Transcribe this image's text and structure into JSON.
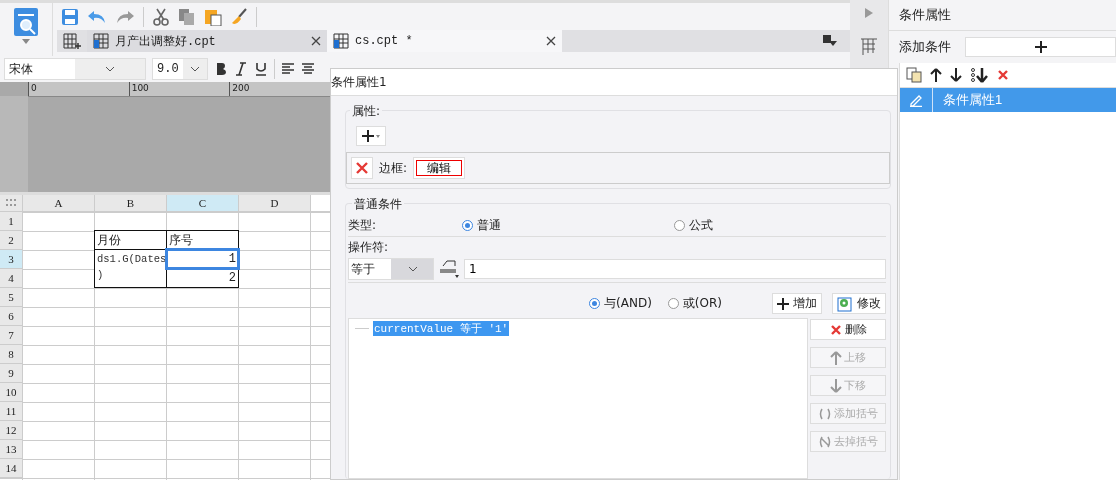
{
  "tabs": [
    {
      "label": "月产出调整好.cpt",
      "selected": false
    },
    {
      "label": "cs.cpt *",
      "selected": true
    }
  ],
  "format_bar": {
    "font": "宋体",
    "size": "9.0"
  },
  "ruler": {
    "ticks": [
      "0",
      "100",
      "200"
    ]
  },
  "sheet": {
    "columns": [
      "A",
      "B",
      "C",
      "D"
    ],
    "rows": [
      {
        "label": "1",
        "cells": [
          null,
          null,
          null,
          null
        ]
      },
      {
        "label": "2",
        "cells": [
          null,
          {
            "kind": "text",
            "lines": [
              "月份"
            ],
            "selected": false,
            "merged_down": false
          },
          {
            "kind": "text",
            "lines": [
              "序号"
            ],
            "selected": false,
            "merged_down": false
          },
          null
        ]
      },
      {
        "label": "3",
        "cells": [
          null,
          {
            "kind": "formula",
            "lines": [
              "ds1.G(Dates",
              ")"
            ],
            "selected": false,
            "merged_down": true
          },
          {
            "kind": "number",
            "lines": [
              "1"
            ],
            "selected": true,
            "merged_down": false
          },
          null
        ]
      },
      {
        "label": "4",
        "cells": [
          null,
          null,
          {
            "kind": "number",
            "lines": [
              "2"
            ],
            "selected": false,
            "merged_down": false
          },
          null
        ]
      },
      {
        "label": "5",
        "cells": [
          null,
          null,
          null,
          null
        ]
      },
      {
        "label": "6",
        "cells": [
          null,
          null,
          null,
          null
        ]
      },
      {
        "label": "7",
        "cells": [
          null,
          null,
          null,
          null
        ]
      },
      {
        "label": "8",
        "cells": [
          null,
          null,
          null,
          null
        ]
      },
      {
        "label": "9",
        "cells": [
          null,
          null,
          null,
          null
        ]
      },
      {
        "label": "10",
        "cells": [
          null,
          null,
          null,
          null
        ]
      },
      {
        "label": "11",
        "cells": [
          null,
          null,
          null,
          null
        ]
      },
      {
        "label": "12",
        "cells": [
          null,
          null,
          null,
          null
        ]
      },
      {
        "label": "13",
        "cells": [
          null,
          null,
          null,
          null
        ]
      },
      {
        "label": "14",
        "cells": [
          null,
          null,
          null,
          null
        ]
      }
    ]
  },
  "dialog": {
    "title": "条件属性1",
    "attributes": {
      "legend": "属性:",
      "items": [
        {
          "label": "边框:",
          "button": "编辑"
        }
      ]
    },
    "condition": {
      "legend": "普通条件",
      "type_label": "类型:",
      "types": [
        {
          "label": "普通",
          "selected": true
        },
        {
          "label": "公式",
          "selected": false
        }
      ],
      "operator_label": "操作符:",
      "operator": "等于",
      "value": "1",
      "joins": [
        {
          "label": "与(AND)",
          "selected": true
        },
        {
          "label": "或(OR)",
          "selected": false
        }
      ],
      "add_button": "增加",
      "modify_button": "修改",
      "list": [
        {
          "text": "currentValue 等于 '1'",
          "selected": true
        }
      ],
      "side_buttons": [
        {
          "label": "删除",
          "kind": "delete",
          "disabled": false
        },
        {
          "label": "上移",
          "kind": "up",
          "disabled": true
        },
        {
          "label": "下移",
          "kind": "down",
          "disabled": true
        },
        {
          "label": "添加括号",
          "kind": "add-brackets",
          "disabled": true
        },
        {
          "label": "去掉括号",
          "kind": "remove-brackets",
          "disabled": true
        }
      ]
    }
  },
  "side_panel": {
    "title": "条件属性",
    "add_label": "添加条件",
    "items": [
      {
        "label": "条件属性1",
        "selected": true
      }
    ]
  }
}
